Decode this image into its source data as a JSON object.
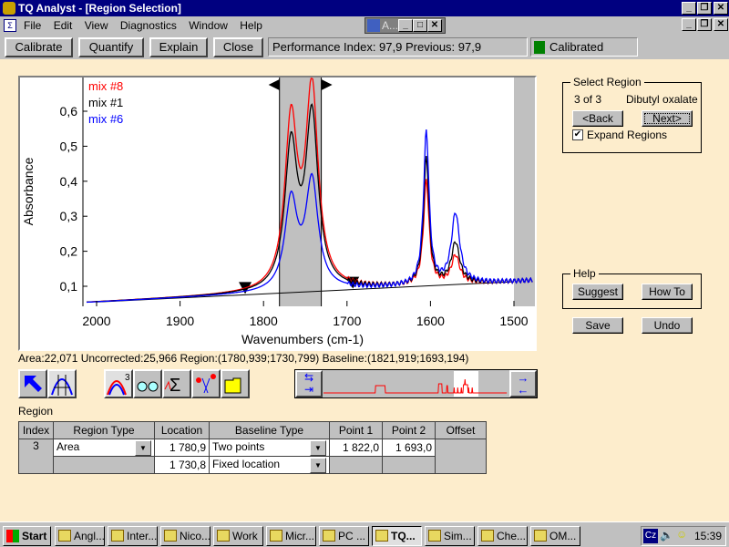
{
  "window": {
    "title": "TQ Analyst  - [Region Selection]",
    "inner_title": "A..."
  },
  "menu": [
    "File",
    "Edit",
    "View",
    "Diagnostics",
    "Window",
    "Help"
  ],
  "toolbar": {
    "calibrate": "Calibrate",
    "quantify": "Quantify",
    "explain": "Explain",
    "close": "Close",
    "performance": "Performance Index:  97,9  Previous:  97,9",
    "status": "Calibrated",
    "status_color": "#008000"
  },
  "chart_data": {
    "type": "line",
    "xlabel": "Wavenumbers (cm-1)",
    "ylabel": "Absorbance",
    "xlim": [
      2015,
      1475
    ],
    "ylim": [
      0.043,
      0.694
    ],
    "xticks": [
      "2000",
      "1900",
      "1800",
      "1700",
      "1600",
      "1500"
    ],
    "yticks": [
      "0,1",
      "0,2",
      "0,3",
      "0,4",
      "0,5",
      "0,6"
    ],
    "legend_position": "top-left",
    "selected_region": [
      1780.9,
      1730.8
    ],
    "baseline_points": [
      1822.0,
      1693.0
    ],
    "baseline": {
      "start": [
        2000,
        0.055
      ],
      "end": [
        1500,
        0.113
      ]
    },
    "series": [
      {
        "name": "mix #8",
        "color": "#ff0000",
        "peaks": [
          [
            1767,
            0.59
          ],
          [
            1742,
            0.69
          ],
          [
            1605,
            0.42
          ],
          [
            1570,
            0.19
          ]
        ]
      },
      {
        "name": "mix #1",
        "color": "#000000",
        "peaks": [
          [
            1767,
            0.515
          ],
          [
            1742,
            0.61
          ],
          [
            1605,
            0.49
          ],
          [
            1570,
            0.23
          ]
        ]
      },
      {
        "name": "mix #6",
        "color": "#0000ff",
        "peaks": [
          [
            1767,
            0.355
          ],
          [
            1742,
            0.415
          ],
          [
            1605,
            0.57
          ],
          [
            1570,
            0.32
          ]
        ]
      }
    ]
  },
  "status_line": "Area:22,071 Uncorrected:25,966 Region:(1780,939;1730,799) Baseline:(1821,919;1693,194)",
  "select_region": {
    "title": "Select Region",
    "position": "3 of 3",
    "component": "Dibutyl oxalate",
    "back": "<Back",
    "next": "Next>",
    "expand": "Expand Regions",
    "expand_checked": true
  },
  "help": {
    "title": "Help",
    "suggest": "Suggest",
    "howto": "How To"
  },
  "save": "Save",
  "undo": "Undo",
  "region": {
    "label": "Region",
    "headers": [
      "Index",
      "Region Type",
      "Location",
      "Baseline Type",
      "Point 1",
      "Point 2",
      "Offset"
    ],
    "index": "3",
    "region_type": "Area",
    "location1": "1 780,9",
    "location2": "1 730,8",
    "baseline1": "Two points",
    "baseline2": "Fixed location",
    "point1": "1 822,0",
    "point2": "1 693,0"
  },
  "taskbar": {
    "start": "Start",
    "items": [
      "Angl...",
      "Inter...",
      "Nico...",
      "Work",
      "Micr...",
      "PC ...",
      "TQ...",
      "Sim...",
      "Che...",
      "OM..."
    ],
    "lang": "Cz",
    "clock": "15:39"
  }
}
